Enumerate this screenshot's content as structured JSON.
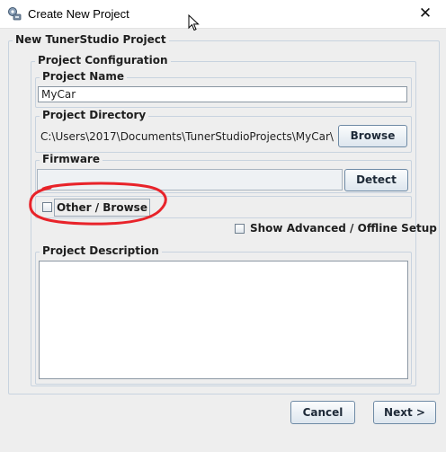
{
  "window": {
    "title": "Create New Project",
    "close_label": "✕"
  },
  "main_group": {
    "title": "New TunerStudio Project"
  },
  "config_group": {
    "title": "Project Configuration"
  },
  "project_name": {
    "label": "Project Name",
    "value": "MyCar"
  },
  "project_directory": {
    "label": "Project Directory",
    "value": "C:\\Users\\2017\\Documents\\TunerStudioProjects\\MyCar\\",
    "browse_label": "Browse"
  },
  "firmware": {
    "label": "Firmware",
    "value": "",
    "detect_label": "Detect",
    "other_browse_label": "Other / Browse",
    "other_browse_checked": false
  },
  "advanced": {
    "label": "Show Advanced / Offline Setup",
    "checked": false
  },
  "description": {
    "label": "Project Description",
    "value": ""
  },
  "footer": {
    "cancel_label": "Cancel",
    "next_label": "Next >"
  },
  "colors": {
    "annotation": "#e8232a",
    "accent_border": "#6e8aa5",
    "background": "#eeeeee"
  },
  "icons": [
    "app-icon",
    "close-icon",
    "mouse-cursor-icon"
  ]
}
